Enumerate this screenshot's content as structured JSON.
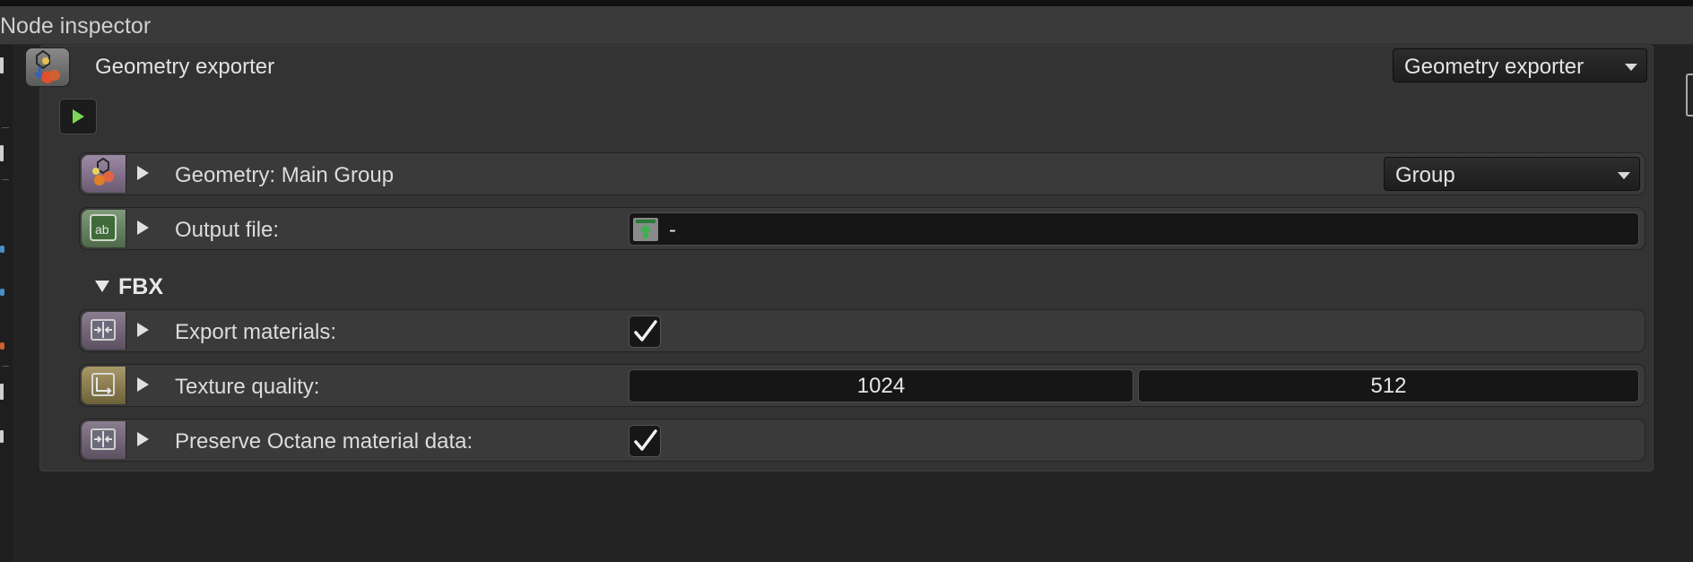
{
  "window": {
    "title": "Node inspector"
  },
  "node": {
    "title": "Geometry exporter",
    "type_dropdown": "Geometry exporter"
  },
  "icons": {
    "node": "geometry-exporter-icon",
    "run": "play-icon"
  },
  "rows": {
    "geometry": {
      "label": "Geometry: Main Group",
      "value": "Group",
      "icon": "geometry-node-icon"
    },
    "output_file": {
      "label": "Output file:",
      "value": "-",
      "icon": "text-ab-icon"
    },
    "section_title": "FBX",
    "export_materials": {
      "label": "Export materials:",
      "checked": true,
      "icon": "bool-toggle-icon"
    },
    "texture_quality": {
      "label": "Texture quality:",
      "value_x": "1024",
      "value_y": "512",
      "icon": "resolution-icon"
    },
    "preserve_octane": {
      "label": "Preserve Octane material data:",
      "checked": true,
      "icon": "bool-toggle-icon"
    }
  },
  "colors": {
    "panel": "#333333",
    "row": "#3a3a3a",
    "field": "#161616",
    "play_green": "#7cd65a",
    "texture_icon_accent": "#8a7a45"
  }
}
